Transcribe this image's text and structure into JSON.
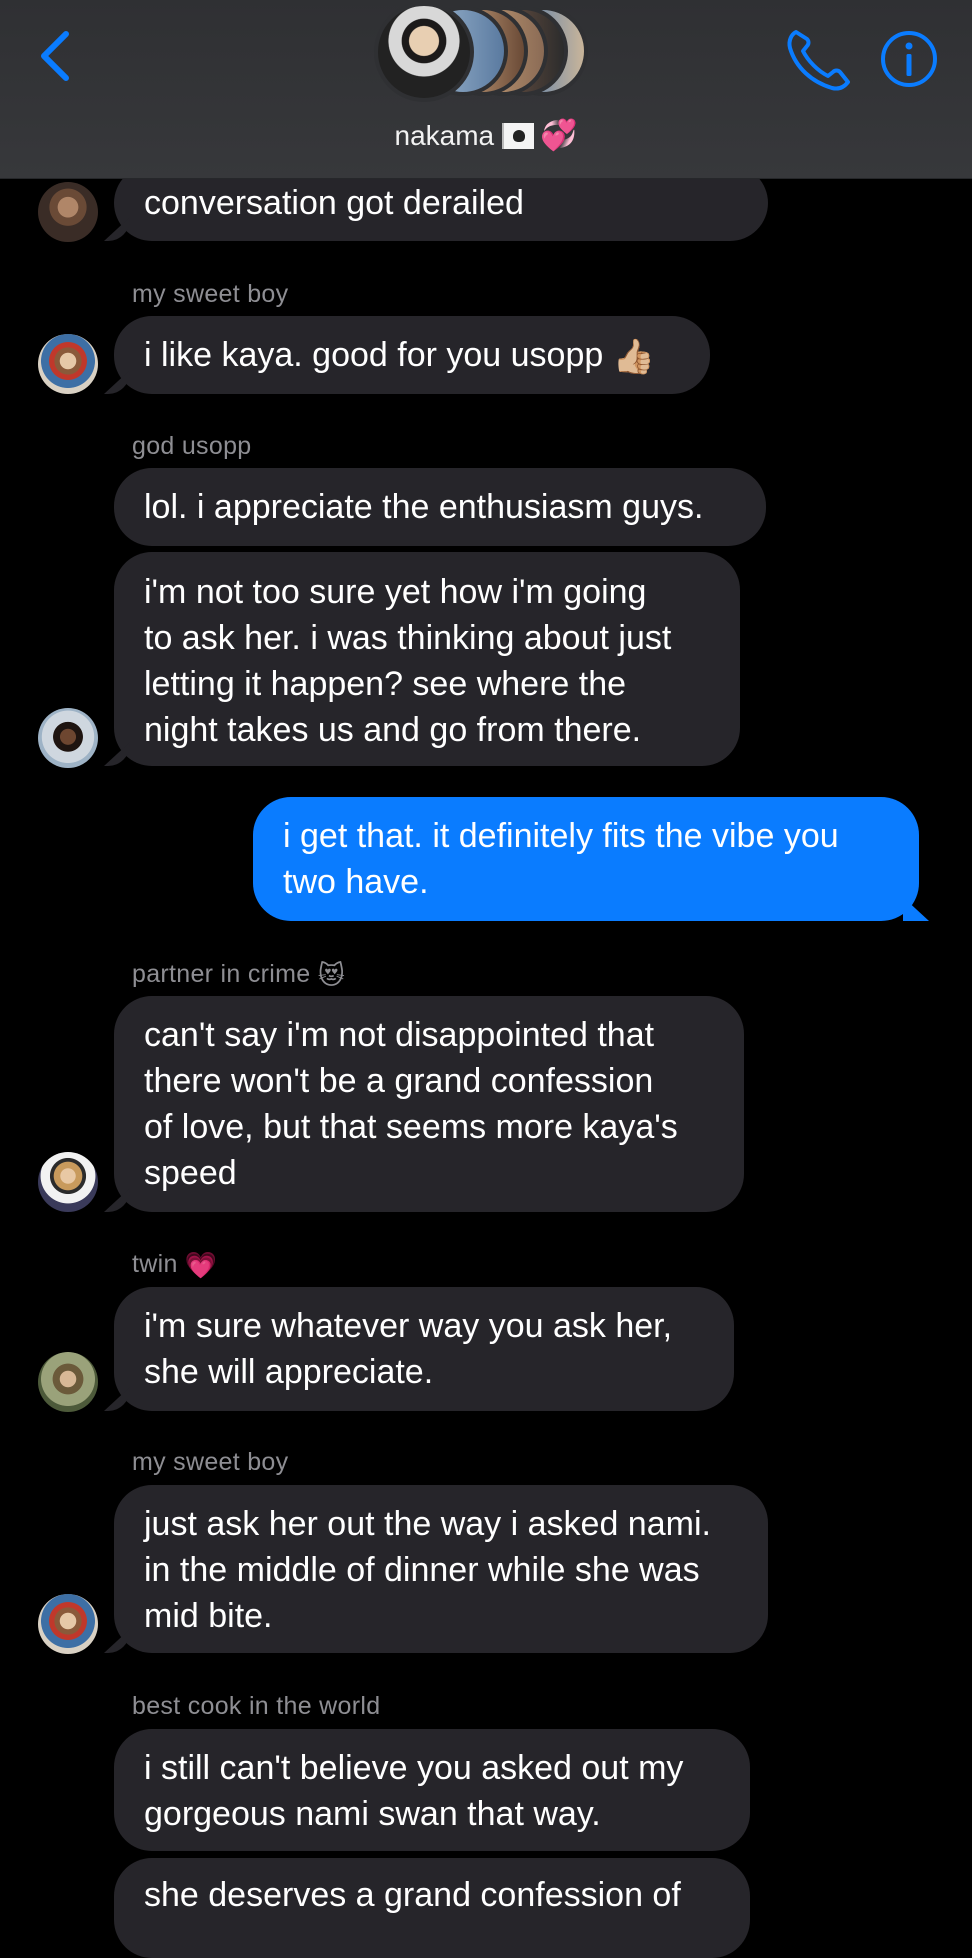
{
  "header": {
    "title": "nakama",
    "title_emoji": "💞",
    "flag_icon": "pirate-flag-icon",
    "accent_color": "#0a7cff"
  },
  "messages": [
    {
      "text": [
        "conversation got derailed"
      ]
    },
    {
      "sender": "my sweet boy",
      "text": [
        "i like kaya. good for you usopp"
      ],
      "emoji": "👍🏼"
    },
    {
      "sender": "god usopp",
      "text": [
        "lol. i appreciate the enthusiasm guys."
      ]
    },
    {
      "text": [
        "i'm not too sure yet how i'm going",
        "to ask her. i was thinking about just",
        "letting it happen? see where the",
        "night takes us and go from there."
      ]
    },
    {
      "text": [
        "i get that. it definitely fits the vibe you",
        "two have."
      ],
      "outgoing": true
    },
    {
      "sender": "partner in crime",
      "sender_emoji": "😻",
      "text": [
        "can't say i'm not disappointed that",
        "there won't be a grand confession",
        "of love, but that seems more kaya's",
        "speed"
      ]
    },
    {
      "sender": "twin",
      "sender_emoji": "💗",
      "text": [
        "i'm sure whatever way you ask her,",
        "she will appreciate."
      ]
    },
    {
      "sender": "my sweet boy",
      "text": [
        "just ask her out the way i asked nami.",
        "in the middle of dinner while she was",
        "mid bite."
      ]
    },
    {
      "sender": "best cook in the world",
      "text": [
        "i still can't believe you asked out my",
        "gorgeous nami swan that way."
      ]
    },
    {
      "text": [
        "she deserves a grand confession of"
      ]
    }
  ]
}
